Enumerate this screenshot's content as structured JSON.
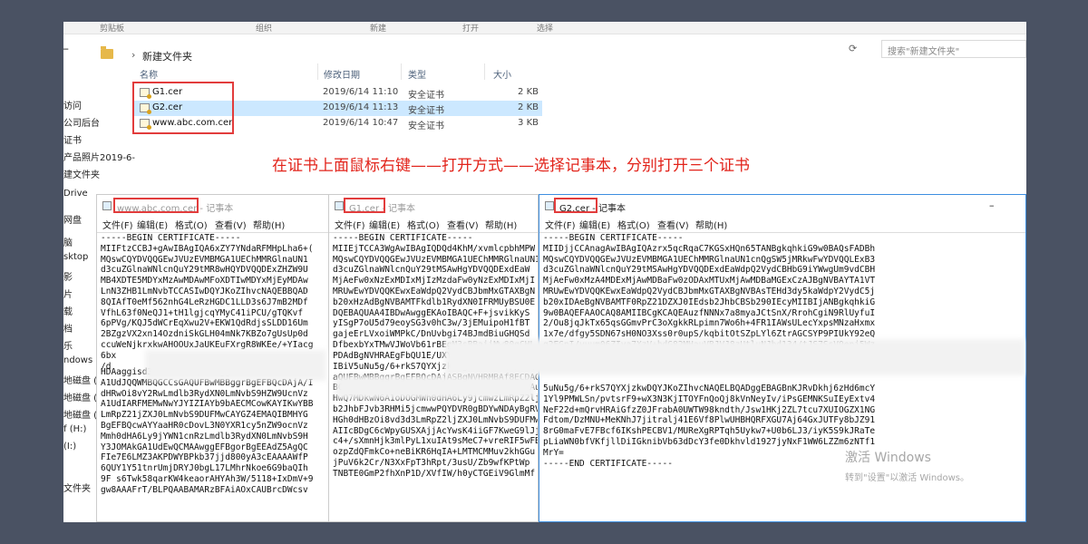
{
  "ribbon": [
    "剪贴板",
    "组织",
    "新建",
    "打开",
    "选择"
  ],
  "address": {
    "back": "←",
    "forward": "→",
    "crumb": "新建文件夹",
    "search_placeholder": "搜索\"新建文件夹\""
  },
  "nav": [
    "访问",
    "公司后台",
    "证书",
    "产品照片2019-6-",
    "建文件夹",
    "Drive",
    "网盘",
    "脑",
    "sktop",
    "影",
    "片",
    "载",
    "档",
    "乐",
    "ndows 1",
    "地磁盘 (E",
    "地磁盘 (G",
    "地磁盘 (G",
    "f (H:)",
    "(I:)",
    "文件夹"
  ],
  "columns": {
    "name": "名称",
    "modified": "修改日期",
    "type": "类型",
    "size": "大小"
  },
  "files": [
    {
      "name": "G1.cer",
      "date": "2019/6/14 11:10",
      "type": "安全证书",
      "size": "2 KB"
    },
    {
      "name": "G2.cer",
      "date": "2019/6/14 11:13",
      "type": "安全证书",
      "size": "2 KB"
    },
    {
      "name": "www.abc.com.cer",
      "date": "2019/6/14 10:47",
      "type": "安全证书",
      "size": "3 KB"
    }
  ],
  "instruction": "在证书上面鼠标右键——打开方式——选择记事本，分别打开三个证书",
  "menu": {
    "file": "文件(F)",
    "edit": "编辑(E)",
    "format": "格式(O)",
    "view": "查看(V)",
    "help": "帮助(H)"
  },
  "notepad1": {
    "title_file": "www.abc.com.cer -",
    "title_app": "记事本",
    "top": "-----BEGIN CERTIFICATE-----\nMIIFtzCCBJ+gAwIBAgIQA6xZY7YNdaRFMHpLha6+(\nMQswCQYDVQQGEwJVUzEVMBMGA1UEChMMRGlnaUN1\nd3cuZGlnaWNlcnQuY29tMR8wHQYDVQQDExZHZW9U\nMB4XDTE5MDYxMzAwMDAwMFoXDTIwMDYxMjEyMDAw\nLnN3ZHB1LmNvbTCCASIwDQYJKoZIhvcNAQEBBQAD\n8QIAfT0eMf562nhG4LeRzHGDC1LLD3s6J7mB2MDf\nVfhL63f0NeQJ1+tH1lgjcqYMyC41iPCU/gTQKvf\n6pPVg/KQJ5dWCrEqXwu2V+EKW1QdRdjsSLDD16Um\n2BZgzVX2xn14OzdniSkGLH04mNk7KBZo7gUsUp0d\nccuWeNjkrxkwAHOOUxJaUKEuFXrgR8WKEe/+YIacg\n6bx\n/d",
    "bottom": "HDAaggisd3cuDukc0uQmz9tggizdZnwd559iJ\nA1UdJQQWMBQGCCsGAQUFBwMBBggrBgEFBQcDAjA/I\ndHRwOi8vY2RwLmdlb3RydXN0LmNvbS9HZW9UcnVz\nA1UdIARFMEMwNwYJYIZIAYb9bAECMCowKAYIKwYBB\nLmRpZ21jZXJ0LmNvbS9DUFMwCAYGZ4EMAQIBMHYG\nBgEFBQcwAYYaaHR0cDovL3N0YXR1cy5nZW9ocnVz\nMmh0dHA6Ly9jYWN1cnRzLmdlb3RydXN0LmNvbS9H\nY3JOMAkGA1UdEwQCMAAwggEFBgorBgEEAdZ5AgQC\nFIe7E6LMZ3AKPDWYBPkb37jjd800yA3cEAAAAWfP\n6QUY1Y51tnrUmjDRYJ0bgL17LMhrNkoe6G9baQIh\n9F s6Twk58qarKW4keaorAHYAh3W/5118+IxDmV+9\ngw8AAAFrT/BLPQAABAMARzBFAiAOxCAUBrcDWcsv"
  },
  "notepad2": {
    "title_file": "G1.cer -",
    "title_app": "记事本",
    "top": "-----BEGIN CERTIFICATE-----\nMIIEjTCCA3WgAwIBAgIQDQd4KhM/xvmlcpbhMPW\nMQswCQYDVQQGEwJVUzEVMBMGA1UEChMMRGlnaUN1\nd3cuZGlnaWNlcnQuY29tMSAwHgYDVQQDExdEaW\nMjAeFw0xNzExMDIxMjIzMzdaFw0yNzExMDIxMjI\nMRUwEwYDVQQKEwxEaWdpQ2VydCBJbmMxGTAXBgN\nb20xHzAdBgNVBAMTFkdlb1RydXN0IFRMUyBSU0E\nDQEBAQUAA4IBDwAwggEKAoIBAQC+F+jsvikKyS\nyISgP7oU5d79eoySG3v0hC3w/3jEMuipoH1fBT\ngajeErLVxoiWMPkC/DnUvbgi74BJmdBiuGHQSd\nDfbexbYxTMwVJWoVb61rBEgM3sBBaiiMw80qCHL",
    "bottom": "PDAdBgNVHRAEgFbQU1E/UXYvkpOkmJFjSZPkA7B\nIBiV5uNu5g/6+rkS7QYXjzkwDgYDVR0PAQH/BAQ\naQUFBwMBBggrBgEFBQcDAjASBgNVHRMBAf8ECDAG\nBCgwJjAkBggrBgEFBQcwAYYYaHR0cDovL29jc3Au\nHwQ7MDkwN6A1oDOGMWh0dHA6Ly9jcmwzLmRpZ2lj\nb2JhbFJvb3RHMi5jcmwwPQYDVR0gBDYwNDAyBgRV\nHGh0dHBzOi8vd3d3LmRpZ2ljZXJ0LmNvbS9DUFMw\nAIIcBDgC6cWpyGUSXAjjAcYwsK4iiGF7KweG9lJj\nc4+/sXmnHjk3mlPyL1xuIAt9sMeC7+vreRIF5wFB\nozpZdQFmkCo+neBiKR6HqIA+LMTMCMMuv2khGGu\njPuV6k2Cr/N3XxFpT3hRpt/3usU/Zb9wfKPtWp\nTNBTE0GmP2fhXnP1D/XVfIW/h0yCTGEiV9GlmMf"
  },
  "notepad3": {
    "title_file": "G2.cer -",
    "title_app": "记事本",
    "top": "-----BEGIN CERTIFICATE-----\nMIIDjjCCAnagAwIBAgIQAzrx5qcRqaC7KGSxHQn65TANBgkqhkiG9w0BAQsFADBh\nMQswCQYDVQQGEwJVUzEVMBMGA1UEChMMRGlnaUN1cnQgSW5jMRkwFwYDVQQLExB3\nd3cuZGlnaWNlcnQuY29tMSAwHgYDVQQDExdEaWdpQ2VydCBHbG9iYWwgUm9vdCBH\nMjAeFw0xMzA4MDExMjAwMDBaFw0zODAxMTUxMjAwMDBaMGExCzAJBgNVBAYTA1VT\nMRUwEwYDVQQKEwxEaWdpQ2VydCBJbmMxGTAXBgNVBAsTEHd3dy5kaWdpY2VydC5j\nb20xIDAeBgNVBAMTF0RpZ21DZXJ0IEdsb2JhbCBSb290IEcyMIIBIjANBgkqhkiG\n9w0BAQEFAAOCAQ8AMIIBCgKCAQEAuzfNNNx7a8myaJCtSnX/RrohCgiN9RlUyfuI\n2/Ou8jqJkTx65qsGGmvPrC3oXgkkRLpimn7Wo6h+4FR1IAWsULecYxpsMNzaHxmx\n1x7e/dfgy5SDN67sH0NO3Xss0r0upS/kqbitOtSZpLYl6ZtrAGCSYP9PIUkY92eQ\nq2EGnI/yuum06ZIya7XzV+hdG82MHauVBJVJ8zUtluNJbd134/tJS7SsVQepj5Wz",
    "bottom": "5uNu5g/6+rkS7QYXjzkwDQYJKoZIhvcNAQELBQADggEBAGBnKJRvDkhj6zHd6mcY\n1Yl9PMWLSn/pvtsrF9+wX3N3KjITOYFnQoQj8kVnNeyIv/iPsGEMNKSuIEyExtv4\nNeF22d+mQrvHRAiGfzZ0JFrabA0UWTW98kndth/Jsw1HKj2ZL7tcu7XUIOGZX1NG\nFdtom/DzMNU+MeKNhJ7jitralj41E6Vf8PlwUHBHQRFXGU7Aj64GxJUTFy8bJZ91\n8rG0maFvE7FBcf6IKshPECBV1/MUReXgRPTqh5Uykw7+U0b6LJ3/iyK5S9kJRaTe\npLiaWN0bfVKfjllDiIGknibVb63dDcY3fe0Dkhvld1927jyNxF1WW6LZZm6zNTf1\nMrY=\n-----END CERTIFICATE-----"
  },
  "watermark": {
    "line1": "激活 Windows",
    "line2": "转到\"设置\"以激活 Windows。"
  }
}
